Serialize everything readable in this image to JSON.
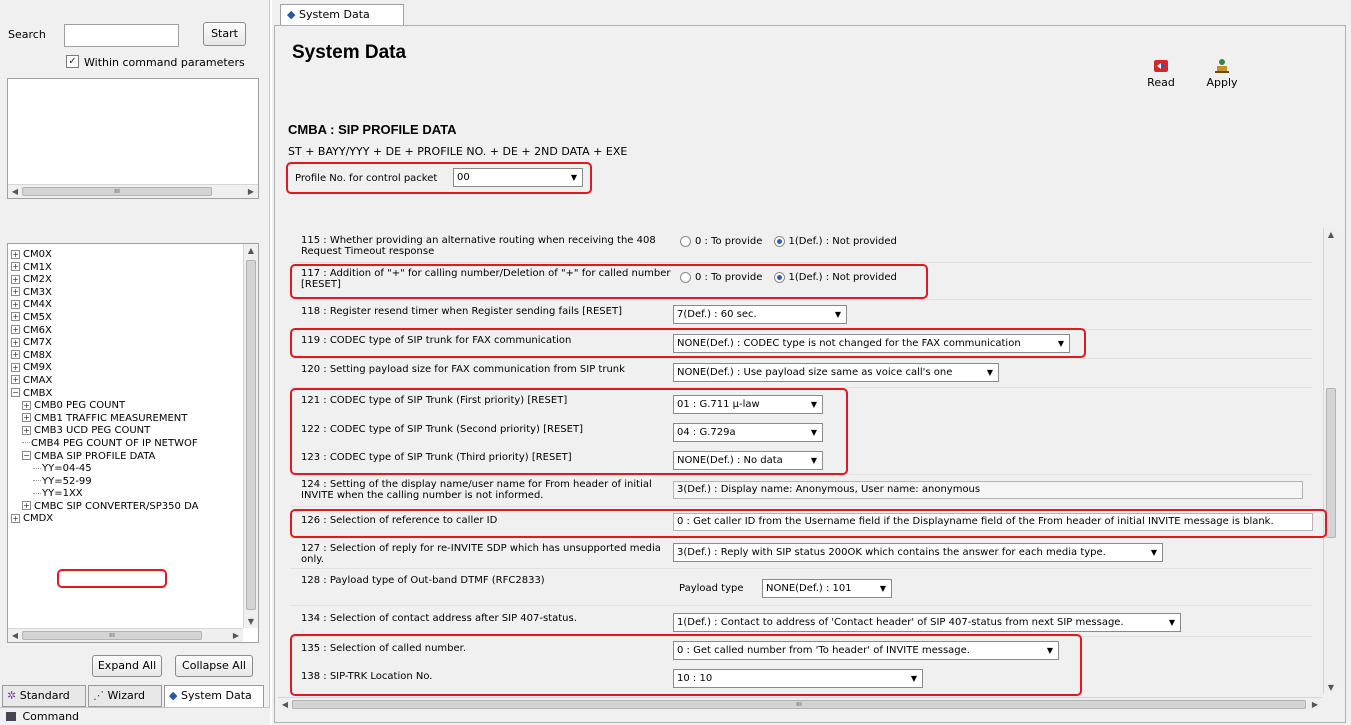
{
  "left": {
    "search_label": "Search",
    "search_value": "",
    "start_button": "Start",
    "within_checkbox_label": "Within command parameters",
    "within_checked": true,
    "tree": [
      {
        "label": "CM0X",
        "level": 0,
        "expander": "+"
      },
      {
        "label": "CM1X",
        "level": 0,
        "expander": "+"
      },
      {
        "label": "CM2X",
        "level": 0,
        "expander": "+"
      },
      {
        "label": "CM3X",
        "level": 0,
        "expander": "+"
      },
      {
        "label": "CM4X",
        "level": 0,
        "expander": "+"
      },
      {
        "label": "CM5X",
        "level": 0,
        "expander": "+"
      },
      {
        "label": "CM6X",
        "level": 0,
        "expander": "+"
      },
      {
        "label": "CM7X",
        "level": 0,
        "expander": "+"
      },
      {
        "label": "CM8X",
        "level": 0,
        "expander": "+"
      },
      {
        "label": "CM9X",
        "level": 0,
        "expander": "+"
      },
      {
        "label": "CMAX",
        "level": 0,
        "expander": "+"
      },
      {
        "label": "CMBX",
        "level": 0,
        "expander": "-"
      },
      {
        "label": "CMB0 PEG COUNT",
        "level": 1,
        "expander": "+"
      },
      {
        "label": "CMB1 TRAFFIC MEASUREMENT",
        "level": 1,
        "expander": "+"
      },
      {
        "label": "CMB3 UCD PEG COUNT",
        "level": 1,
        "expander": "+"
      },
      {
        "label": "CMB4 PEG COUNT OF IP NETWOF",
        "level": 1,
        "expander": ""
      },
      {
        "label": "CMBA SIP PROFILE DATA",
        "level": 1,
        "expander": "-"
      },
      {
        "label": "YY=04-45",
        "level": 2,
        "expander": ""
      },
      {
        "label": "YY=52-99",
        "level": 2,
        "expander": ""
      },
      {
        "label": "YY=1XX",
        "level": 2,
        "expander": ""
      },
      {
        "label": "CMBC SIP CONVERTER/SP350 DA",
        "level": 1,
        "expander": "+"
      },
      {
        "label": "CMDX",
        "level": 0,
        "expander": "+"
      }
    ],
    "expand_all": "Expand All",
    "collapse_all": "Collapse All",
    "tabs": [
      "Standard",
      "Wizard",
      "System Data"
    ],
    "command_label": "Command"
  },
  "right": {
    "tab_label": "System Data",
    "title": "System Data",
    "read_label": "Read",
    "apply_label": "Apply",
    "section_title": "CMBA : SIP PROFILE DATA",
    "command_format": "ST + BAYY/YYY + DE + PROFILE NO. + DE + 2ND DATA + EXE",
    "profile_label": "Profile No. for control packet",
    "profile_value": "00",
    "radio_opt0": "0 : To provide",
    "radio_opt1": "1(Def.) : Not provided",
    "rows": {
      "r115": "115 : Whether providing an alternative routing when receiving the 408 Request Timeout response",
      "r117": "117 : Addition of \"+\" for calling number/Deletion of \"+\" for called number [RESET]",
      "r118": "118 : Register resend timer when Register sending fails [RESET]",
      "r118v": "7(Def.) : 60 sec.",
      "r119": "119 : CODEC type of SIP trunk for FAX communication",
      "r119v": "NONE(Def.) : CODEC type is not changed for the FAX communication",
      "r120": "120 : Setting payload size for FAX communication from SIP trunk",
      "r120v": "NONE(Def.) : Use payload size same as voice call's one",
      "r121": "121 : CODEC type of SIP Trunk (First priority) [RESET]",
      "r121v": "01 : G.711 μ-law",
      "r122": "122 : CODEC type of SIP Trunk (Second priority) [RESET]",
      "r122v": "04 : G.729a",
      "r123": "123 : CODEC type of SIP Trunk (Third priority) [RESET]",
      "r123v": "NONE(Def.) : No data",
      "r124": "124 : Setting of the display name/user name for From header of initial INVITE when the calling number is not informed.",
      "r124v": "3(Def.) : Display name: Anonymous, User name: anonymous",
      "r126": "126 : Selection of reference to caller ID",
      "r126v": "0 : Get caller ID from the Username field if the Displayname field of the From header of initial INVITE message is blank.",
      "r127": "127 : Selection of reply for re-INVITE SDP which has unsupported media only.",
      "r127v": "3(Def.) : Reply with SIP status 200OK which contains the answer for each media type.",
      "r128": "128 : Payload type of Out-band DTMF (RFC2833)",
      "r128_sub": "Payload type",
      "r128v": "NONE(Def.) : 101",
      "r134": "134 : Selection of contact address after SIP 407-status.",
      "r134v": "1(Def.) : Contact to address of 'Contact header' of SIP 407-status from next SIP message.",
      "r135": "135 : Selection of called number.",
      "r135v": "0 : Get called number from 'To header' of INVITE message.",
      "r138": "138 : SIP-TRK Location No.",
      "r138v": "10 : 10"
    },
    "highlight_color": "#e0191e"
  }
}
